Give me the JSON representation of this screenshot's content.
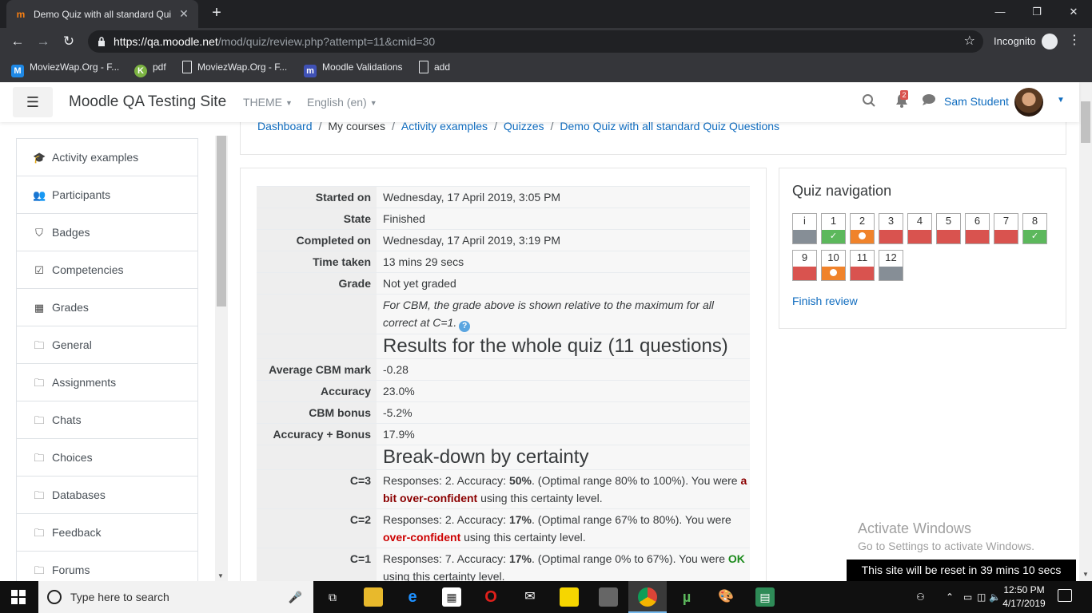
{
  "browser": {
    "tab_title": "Demo Quiz with all standard Qui",
    "tab_favicon": "m",
    "url_host": "https://qa.moodle.net",
    "url_path": "/mod/quiz/review.php?attempt=11&cmid=30",
    "incognito_label": "Incognito",
    "bookmarks": [
      {
        "label": "MoviezWap.Org - F...",
        "icon": "M",
        "color": "#1e88e5"
      },
      {
        "label": "pdf",
        "icon": "K",
        "color": "#7cb342"
      },
      {
        "label": "MoviezWap.Org - F...",
        "icon": "",
        "color": ""
      },
      {
        "label": "Moodle Validations",
        "icon": "m",
        "color": "#3f51b5"
      },
      {
        "label": "add",
        "icon": "",
        "color": ""
      }
    ]
  },
  "navbar": {
    "site_name": "Moodle QA Testing Site",
    "theme_label": "THEME",
    "language_label": "English (en)",
    "notification_count": "2",
    "user_name": "Sam Student"
  },
  "block_nav": {
    "items": [
      {
        "label": "Activity examples",
        "icon": "graduation-cap-icon",
        "glyph": "🎓"
      },
      {
        "label": "Participants",
        "icon": "users-icon",
        "glyph": "👥"
      },
      {
        "label": "Badges",
        "icon": "shield-icon",
        "glyph": "⛉"
      },
      {
        "label": "Competencies",
        "icon": "check-square-icon",
        "glyph": "☑"
      },
      {
        "label": "Grades",
        "icon": "table-icon",
        "glyph": "▦"
      },
      {
        "label": "General",
        "icon": "folder-icon",
        "glyph": "🗀"
      },
      {
        "label": "Assignments",
        "icon": "folder-icon",
        "glyph": "🗀"
      },
      {
        "label": "Chats",
        "icon": "folder-icon",
        "glyph": "🗀"
      },
      {
        "label": "Choices",
        "icon": "folder-icon",
        "glyph": "🗀"
      },
      {
        "label": "Databases",
        "icon": "folder-icon",
        "glyph": "🗀"
      },
      {
        "label": "Feedback",
        "icon": "folder-icon",
        "glyph": "🗀"
      },
      {
        "label": "Forums",
        "icon": "folder-icon",
        "glyph": "🗀"
      }
    ]
  },
  "breadcrumb": {
    "items": [
      {
        "label": "Dashboard",
        "link": true
      },
      {
        "label": "My courses",
        "link": false
      },
      {
        "label": "Activity examples",
        "link": true
      },
      {
        "label": "Quizzes",
        "link": true
      },
      {
        "label": "Demo Quiz with all standard Quiz Questions",
        "link": true
      }
    ]
  },
  "summary": {
    "started_on_label": "Started on",
    "started_on": "Wednesday, 17 April 2019, 3:05 PM",
    "state_label": "State",
    "state": "Finished",
    "completed_on_label": "Completed on",
    "completed_on": "Wednesday, 17 April 2019, 3:19 PM",
    "time_taken_label": "Time taken",
    "time_taken": "13 mins 29 secs",
    "grade_label": "Grade",
    "grade": "Not yet graded",
    "cbm_note": "For CBM, the grade above is shown relative to the maximum for all correct at C=1.",
    "results_heading": "Results for the whole quiz (11 questions)",
    "avg_cbm_label": "Average CBM mark",
    "avg_cbm": "-0.28",
    "accuracy_label": "Accuracy",
    "accuracy": "23.0%",
    "cbm_bonus_label": "CBM bonus",
    "cbm_bonus": "-5.2%",
    "acc_bonus_label": "Accuracy + Bonus",
    "acc_bonus": "17.9%",
    "breakdown_heading": "Break-down by certainty",
    "c3_label": "C=3",
    "c3_pre": "Responses: 2. Accuracy: ",
    "c3_pct": "50%",
    "c3_mid": ". (Optimal range 80% to 100%). You were ",
    "c3_judg": "a bit over-confident",
    "c3_post": " using this certainty level.",
    "c2_label": "C=2",
    "c2_pre": "Responses: 2. Accuracy: ",
    "c2_pct": "17%",
    "c2_mid": ". (Optimal range 67% to 80%). You were ",
    "c2_judg": "over-confident",
    "c2_post": " using this certainty level.",
    "c1_label": "C=1",
    "c1_pre": "Responses: 7. Accuracy: ",
    "c1_pct": "17%",
    "c1_mid": ". (Optimal range 0% to 67%). You were ",
    "c1_judg": "OK",
    "c1_post": " using this certainty level."
  },
  "quiz_nav": {
    "title": "Quiz navigation",
    "finish_label": "Finish review",
    "buttons": [
      {
        "num": "i",
        "state": "grey",
        "mark": ""
      },
      {
        "num": "1",
        "state": "green",
        "mark": "✓"
      },
      {
        "num": "2",
        "state": "orange",
        "mark": "dot"
      },
      {
        "num": "3",
        "state": "red",
        "mark": ""
      },
      {
        "num": "4",
        "state": "red",
        "mark": ""
      },
      {
        "num": "5",
        "state": "red",
        "mark": ""
      },
      {
        "num": "6",
        "state": "red",
        "mark": ""
      },
      {
        "num": "7",
        "state": "red",
        "mark": ""
      },
      {
        "num": "8",
        "state": "green",
        "mark": "✓"
      },
      {
        "num": "9",
        "state": "red",
        "mark": ""
      },
      {
        "num": "10",
        "state": "orange",
        "mark": "dot"
      },
      {
        "num": "11",
        "state": "red",
        "mark": ""
      },
      {
        "num": "12",
        "state": "grey",
        "mark": ""
      }
    ]
  },
  "watermark": {
    "line1": "Activate Windows",
    "line2": "Go to Settings to activate Windows."
  },
  "reset_banner": "This site will be reset in 39 mins 10 secs",
  "taskbar": {
    "search_placeholder": "Type here to search",
    "time": "12:50 PM",
    "date": "4/17/2019"
  }
}
